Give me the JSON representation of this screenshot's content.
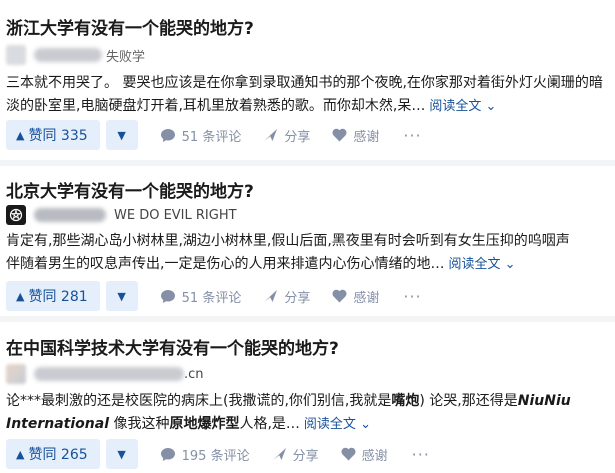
{
  "colors": {
    "accent": "#175199",
    "vote_bg": "#e5eefb",
    "muted": "#8590a6"
  },
  "feed": [
    {
      "question": "浙江大学有没有一个能哭的地方?",
      "author_name_visible": "",
      "author_bio": "失败学",
      "excerpt_line1": "三本就不用哭了。 要哭也应该是在你拿到录取通知书的那个夜晚,在你家那对着街外灯火阑珊的暗",
      "excerpt_line2": "淡的卧室里,电脑硬盘灯开着,耳机里放着熟悉的歌。而你却木然,呆…",
      "read_more": "阅读全文",
      "vote_label": "赞同 335",
      "comments_label": "51 条评论",
      "share_label": "分享",
      "thanks_label": "感谢",
      "more_label": "···"
    },
    {
      "question": "北京大学有没有一个能哭的地方?",
      "author_name_visible": "",
      "author_bio": "WE DO EVIL RIGHT",
      "excerpt_line1": "肯定有,那些湖心岛小树林里,湖边小树林里,假山后面,黑夜里有时会听到有女生压抑的呜咽声",
      "excerpt_line2": "伴随着男生的叹息声传出,一定是伤心的人用来排遣内心伤心情绪的地…",
      "read_more": "阅读全文",
      "vote_label": "赞同 281",
      "comments_label": "51 条评论",
      "share_label": "分享",
      "thanks_label": "感谢",
      "more_label": "···"
    },
    {
      "question": "在中国科学技术大学有没有一个能哭的地方?",
      "author_name_visible": ".cn",
      "author_bio": "",
      "excerpt_l1_a": "论***最刺激的还是校医院的病床上(我撒谎的,你们别信,我就是",
      "excerpt_l1_bold": "嘴炮",
      "excerpt_l1_b": ") 论哭,那还得是",
      "excerpt_l1_em": "NiuNiu",
      "excerpt_l2_em": "International",
      "excerpt_l2_a": " 像我这种",
      "excerpt_l2_bold": "原地爆炸型",
      "excerpt_l2_b": "人格,是…",
      "read_more": "阅读全文",
      "vote_label": "赞同 265",
      "comments_label": "195 条评论",
      "share_label": "分享",
      "thanks_label": "感谢",
      "more_label": "···"
    }
  ]
}
